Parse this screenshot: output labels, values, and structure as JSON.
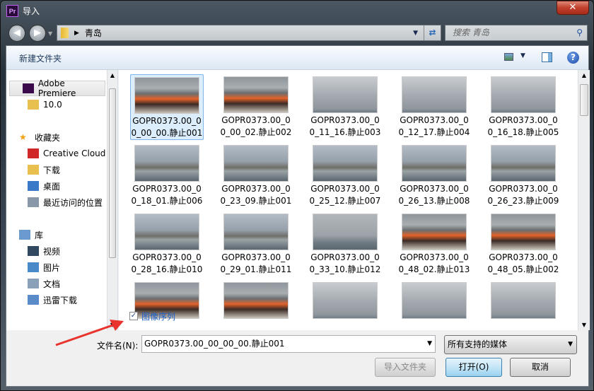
{
  "window": {
    "title": "导入",
    "app_icon": "Pr",
    "close": "✕"
  },
  "nav": {
    "path": "青岛",
    "search_placeholder": "搜索 青岛"
  },
  "toolbar": {
    "new_folder": "新建文件夹"
  },
  "sidebar": {
    "items": [
      {
        "label": "Adobe Premiere",
        "icon": "premiere-icon",
        "selected": true
      },
      {
        "label": "10.0",
        "icon": "folder-icon"
      },
      {
        "label": "收藏夹",
        "icon": "star-icon",
        "group": true
      },
      {
        "label": "Creative Cloud",
        "icon": "creative-cloud-icon"
      },
      {
        "label": "下载",
        "icon": "download-folder-icon"
      },
      {
        "label": "桌面",
        "icon": "desktop-icon"
      },
      {
        "label": "最近访问的位置",
        "icon": "recent-places-icon"
      },
      {
        "label": "库",
        "icon": "library-icon",
        "group": true
      },
      {
        "label": "视频",
        "icon": "video-icon"
      },
      {
        "label": "图片",
        "icon": "pictures-icon"
      },
      {
        "label": "文档",
        "icon": "documents-icon"
      },
      {
        "label": "迅雷下载",
        "icon": "thunder-download-icon"
      }
    ]
  },
  "files": [
    {
      "l1": "GOPR0373.00_0",
      "l2": "0_00_00.静止001",
      "kind": "people",
      "selected": true
    },
    {
      "l1": "GOPR0373.00_0",
      "l2": "0_00_02.静止002",
      "kind": "people"
    },
    {
      "l1": "GOPR0373.00_0",
      "l2": "0_11_16.静止003",
      "kind": "sky"
    },
    {
      "l1": "GOPR0373.00_0",
      "l2": "0_12_17.静止004",
      "kind": "sky"
    },
    {
      "l1": "GOPR0373.00_0",
      "l2": "0_16_18.静止005",
      "kind": "sky"
    },
    {
      "l1": "GOPR0373.00_0",
      "l2": "0_18_01.静止006",
      "kind": "city"
    },
    {
      "l1": "GOPR0373.00_0",
      "l2": "0_23_09.静止001",
      "kind": "city"
    },
    {
      "l1": "GOPR0373.00_0",
      "l2": "0_25_12.静止007",
      "kind": "city"
    },
    {
      "l1": "GOPR0373.00_0",
      "l2": "0_26_13.静止008",
      "kind": "city"
    },
    {
      "l1": "GOPR0373.00_0",
      "l2": "0_26_23.静止009",
      "kind": "city"
    },
    {
      "l1": "GOPR0373.00_0",
      "l2": "0_28_16.静止010",
      "kind": "city"
    },
    {
      "l1": "GOPR0373.00_0",
      "l2": "0_29_01.静止011",
      "kind": "city"
    },
    {
      "l1": "GOPR0373.00_0",
      "l2": "0_33_10.静止012",
      "kind": "sea"
    },
    {
      "l1": "GOPR0373.00_0",
      "l2": "0_48_02.静止013",
      "kind": "people"
    },
    {
      "l1": "GOPR0373.00_0",
      "l2": "0_48_05.静止002",
      "kind": "people"
    },
    {
      "l1": "",
      "l2": "",
      "kind": "people"
    },
    {
      "l1": "",
      "l2": "",
      "kind": "people"
    },
    {
      "l1": "",
      "l2": "",
      "kind": "sky"
    },
    {
      "l1": "",
      "l2": "",
      "kind": "sky"
    },
    {
      "l1": "",
      "l2": "",
      "kind": "sky"
    }
  ],
  "options": {
    "image_sequence_label": "图像序列",
    "image_sequence_checked": true
  },
  "footer": {
    "filename_label": "文件名(N):",
    "filename_value": "GOPR0373.00_00_00_00.静止001",
    "filetype": "所有支持的媒体",
    "import_folder": "导入文件夹",
    "open": "打开(O)",
    "cancel": "取消"
  }
}
